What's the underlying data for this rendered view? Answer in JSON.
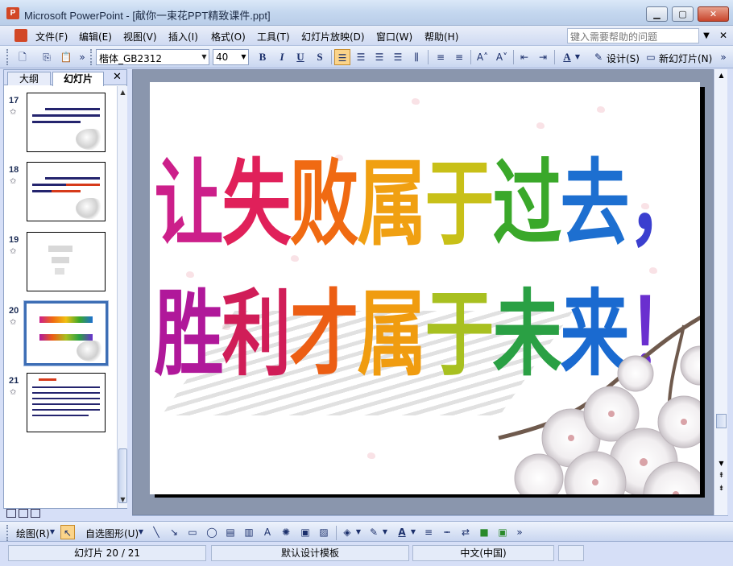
{
  "window": {
    "title": "Microsoft PowerPoint - [献你一束花PPT精致课件.ppt]",
    "app_icon": "powerpoint-icon"
  },
  "menu": {
    "items": [
      "文件(F)",
      "编辑(E)",
      "视图(V)",
      "插入(I)",
      "格式(O)",
      "工具(T)",
      "幻灯片放映(D)",
      "窗口(W)",
      "帮助(H)"
    ],
    "help_placeholder": "键入需要帮助的问题"
  },
  "toolbar": {
    "font_name": "楷体_GB2312",
    "font_size": "40",
    "bold": "B",
    "italic": "I",
    "underline": "U",
    "shadow": "S",
    "design_label": "设计(S)",
    "new_slide_label": "新幻灯片(N)"
  },
  "left_pane": {
    "tabs": [
      "大纲",
      "幻灯片"
    ],
    "slides": [
      {
        "number": "17",
        "selected": false
      },
      {
        "number": "18",
        "selected": false
      },
      {
        "number": "19",
        "selected": false
      },
      {
        "number": "20",
        "selected": true
      },
      {
        "number": "21",
        "selected": false
      }
    ]
  },
  "slide": {
    "line1": "让失败属于过去，",
    "line2": "胜利才属于未来！",
    "line1_colors": [
      "#cc1f8a",
      "#e0205a",
      "#f06a12",
      "#f0a012",
      "#c8c018",
      "#3aa82a",
      "#1d6fd0",
      "#3b3fcf"
    ],
    "line2_colors": [
      "#b0189a",
      "#d01d58",
      "#ec5e14",
      "#f09c10",
      "#a8c020",
      "#2aa044",
      "#1a6ad0",
      "#6a2fcf",
      "#b020b0"
    ]
  },
  "drawing_toolbar": {
    "draw_label": "绘图(R)",
    "autoshapes_label": "自选图形(U)"
  },
  "status": {
    "slide_position": "幻灯片 20 / 21",
    "template": "默认设计模板",
    "language": "中文(中国)"
  }
}
